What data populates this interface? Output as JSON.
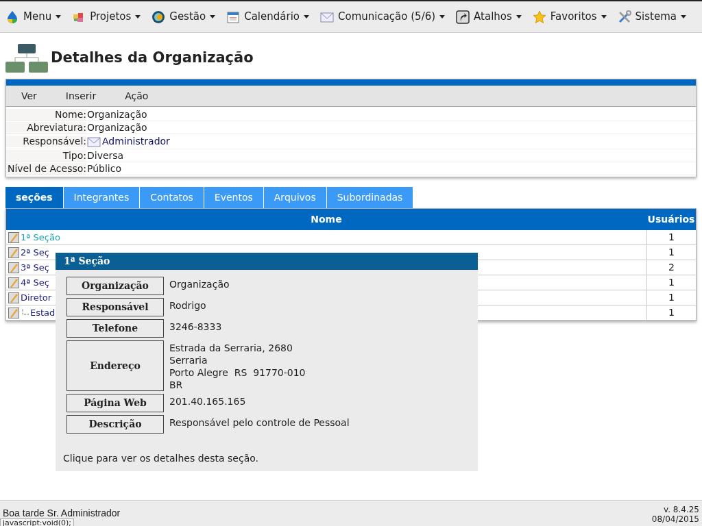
{
  "menu": [
    {
      "label": "Menu"
    },
    {
      "label": "Projetos"
    },
    {
      "label": "Gestão"
    },
    {
      "label": "Calendário"
    },
    {
      "label": "Comunicação (5/6)"
    },
    {
      "label": "Atalhos"
    },
    {
      "label": "Favoritos"
    },
    {
      "label": "Sistema"
    }
  ],
  "page_title": "Detalhes da Organização",
  "actions": [
    "Ver",
    "Inserir",
    "Ação"
  ],
  "details": [
    {
      "label": "Nome:",
      "value": "Organização",
      "kind": "text"
    },
    {
      "label": "Abreviatura:",
      "value": "Organização",
      "kind": "text"
    },
    {
      "label": "Responsável:",
      "value": "Administrador",
      "kind": "user"
    },
    {
      "label": "Tipo:",
      "value": "Diversa",
      "kind": "text"
    },
    {
      "label": "Nível de Acesso:",
      "value": "Público",
      "kind": "text"
    }
  ],
  "tabs": [
    {
      "label": "seções",
      "selected": true
    },
    {
      "label": "Integrantes",
      "selected": false
    },
    {
      "label": "Contatos",
      "selected": false
    },
    {
      "label": "Eventos",
      "selected": false
    },
    {
      "label": "Arquivos",
      "selected": false
    },
    {
      "label": "Subordinadas",
      "selected": false
    }
  ],
  "table": {
    "columns": [
      "Nome",
      "Usuários"
    ],
    "rows": [
      {
        "name": "1ª Seção",
        "users": "1",
        "hovered": true,
        "children": []
      },
      {
        "name": "2ª Seç",
        "users": "1",
        "hovered": false,
        "children": []
      },
      {
        "name": "3ª Seç",
        "users": "2",
        "hovered": false,
        "children": []
      },
      {
        "name": "4ª Seç",
        "users": "1",
        "hovered": false,
        "children": []
      },
      {
        "name": "Diretor",
        "users": "1",
        "hovered": false,
        "children": [
          {
            "name": "Estad",
            "users": "1",
            "hovered": false
          }
        ]
      }
    ]
  },
  "tooltip": {
    "title": "1ª Seção",
    "fields": [
      {
        "label": "Organização",
        "lines": [
          "Organização"
        ]
      },
      {
        "label": "Responsável",
        "lines": [
          "Rodrigo"
        ]
      },
      {
        "label": "Telefone",
        "lines": [
          "3246-8333"
        ]
      },
      {
        "label": "Endereço",
        "lines": [
          "Estrada da Serraria, 2680",
          "Serraria",
          "Porto Alegre  RS  91770-010",
          "BR"
        ]
      },
      {
        "label": "Página Web",
        "lines": [
          "201.40.165.165"
        ]
      },
      {
        "label": "Descrição",
        "lines": [
          "Responsável pelo controle de Pessoal"
        ]
      }
    ],
    "hint": "Clique para ver os detalhes desta seção."
  },
  "footer": {
    "greeting": "Boa tarde Sr. Administrador",
    "version": "v. 8.4.25",
    "date": "08/04/2015",
    "status_url": "javascript:void(0);"
  }
}
